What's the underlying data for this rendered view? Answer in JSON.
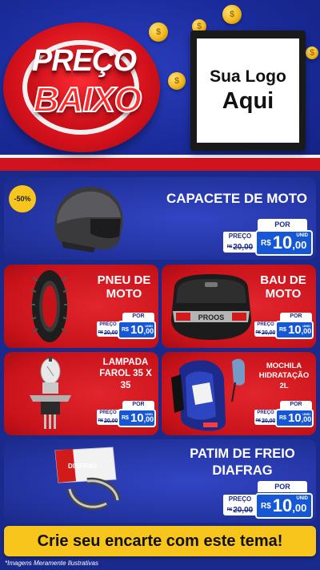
{
  "header": {
    "title_line1": "PREÇO",
    "title_line2": "BAIXO",
    "logo_line1": "Sua Logo",
    "logo_line2": "Aqui"
  },
  "price_labels": {
    "preco": "PREÇO",
    "por": "POR",
    "currency": "R$",
    "unid": "UNID"
  },
  "products": [
    {
      "name": "CAPACETE DE MOTO",
      "discount": "-50%",
      "old_price": "20,00",
      "new_price_int": "10",
      "new_price_dec": ",00",
      "icon": "helmet-icon"
    },
    {
      "name_line1": "PNEU DE",
      "name_line2": "MOTO",
      "old_price": "20,00",
      "new_price_int": "10",
      "new_price_dec": ",00",
      "icon": "tire-icon"
    },
    {
      "name_line1": "BAU DE",
      "name_line2": "MOTO",
      "old_price": "20,00",
      "new_price_int": "10",
      "new_price_dec": ",00",
      "icon": "top-case-icon",
      "brand_on_product": "PROOS"
    },
    {
      "name_line1": "LAMPADA",
      "name_line2": "FAROL 35 X",
      "name_line3": "35",
      "old_price": "20,00",
      "new_price_int": "10",
      "new_price_dec": ",00",
      "icon": "headlight-bulb-icon"
    },
    {
      "name_line1": "MOCHILA",
      "name_line2": "HIDRATAÇÃO",
      "name_line3": "2L",
      "old_price": "20,00",
      "new_price_int": "10",
      "new_price_dec": ",00",
      "icon": "hydration-backpack-icon"
    },
    {
      "name_line1": "PATIM DE FREIO",
      "name_line2": "DIAFRAG",
      "old_price": "20,00",
      "new_price_int": "10",
      "new_price_dec": ",00",
      "icon": "brake-shoe-icon",
      "brand_on_product": "DIAFRAG"
    }
  ],
  "footer": {
    "cta": "Crie seu encarte com este tema!",
    "disclaimer": "*Imagens Meramente Ilustrativas"
  }
}
